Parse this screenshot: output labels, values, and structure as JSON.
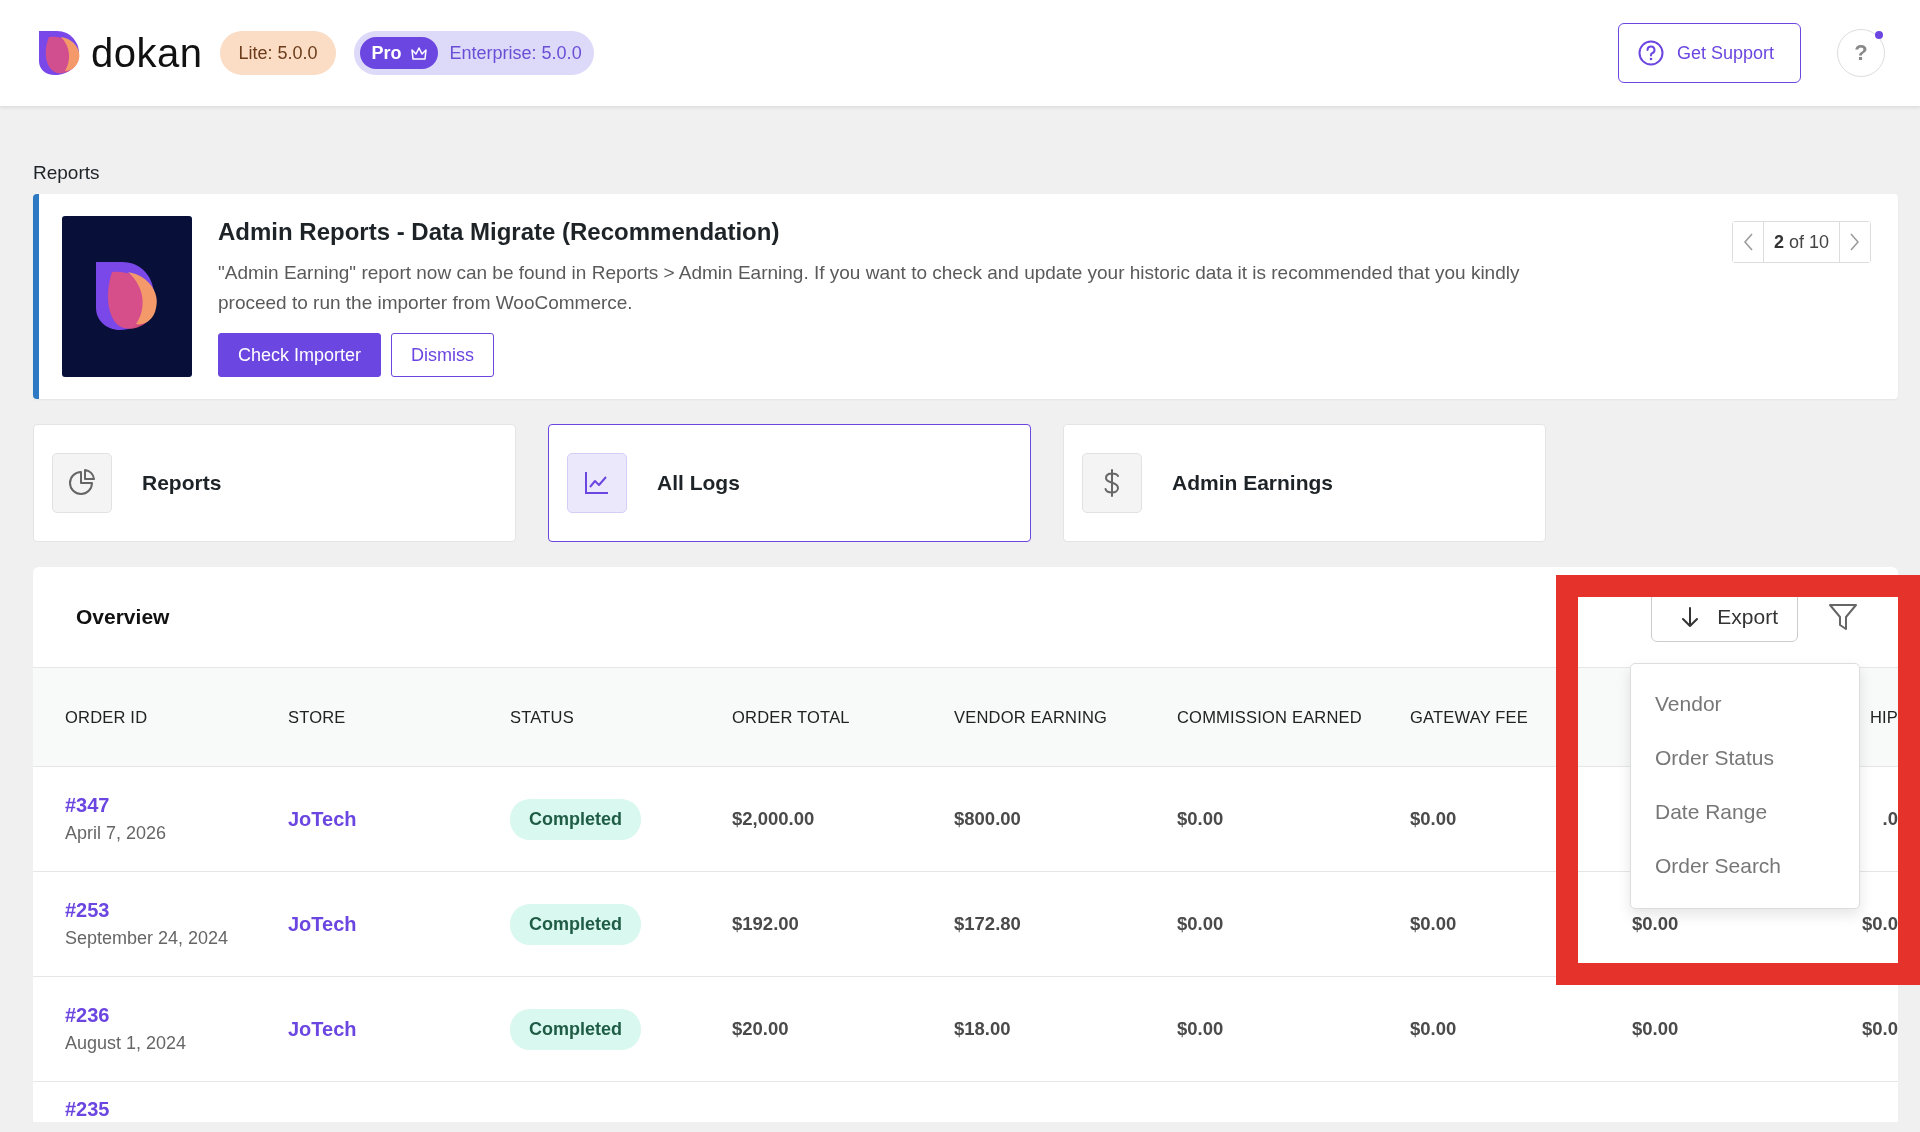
{
  "header": {
    "logo_text": "dokan",
    "lite_badge": "Lite: 5.0.0",
    "pro_badge": "Pro",
    "enterprise_badge": "Enterprise: 5.0.0",
    "support_button": "Get Support",
    "help_button": "?",
    "help_notification": true
  },
  "page_title": "Reports",
  "notice": {
    "title": "Admin Reports - Data Migrate (Recommendation)",
    "message": "\"Admin Earning\" report now can be found in Reports > Admin Earning. If you want to check and update your historic data it is recommended that you kindly proceed to run the importer from WooCommerce.",
    "buttons": [
      {
        "label": "Check Importer",
        "kind": "primary"
      },
      {
        "label": "Dismiss",
        "kind": "outline"
      }
    ],
    "pager": {
      "current": "2",
      "total": "of 10"
    }
  },
  "tabs": [
    {
      "label": "Reports",
      "kind": "pie",
      "selected": false
    },
    {
      "label": "All Logs",
      "kind": "line",
      "selected": true
    },
    {
      "label": "Admin Earnings",
      "kind": "dollar",
      "selected": false
    }
  ],
  "overview": {
    "title": "Overview",
    "export_button": "Export",
    "filter_menu": {
      "items": [
        "Vendor",
        "Order Status",
        "Date Range",
        "Order Search"
      ]
    },
    "table": {
      "columns": [
        "ORDER ID",
        "STORE",
        "STATUS",
        "ORDER TOTAL",
        "VENDOR EARNING",
        "COMMISSION EARNED",
        "GATEWAY FEE",
        null,
        "HIP"
      ],
      "rows": [
        {
          "order_id": "#347",
          "date": "April 7, 2026",
          "store": "JoTech",
          "status": "Completed",
          "order_total": "$2,000.00",
          "vendor_earning": "$800.00",
          "commission_earned": "$0.00",
          "gateway_fee": "$0.00",
          "column_9": ".0"
        },
        {
          "order_id": "#253",
          "date": "September 24, 2024",
          "store": "JoTech",
          "status": "Completed",
          "order_total": "$192.00",
          "vendor_earning": "$172.80",
          "commission_earned": "$0.00",
          "gateway_fee": "$0.00",
          "column_8": "$0.00",
          "column_9": "$0.0"
        },
        {
          "order_id": "#236",
          "date": "August 1, 2024",
          "store": "JoTech",
          "status": "Completed",
          "order_total": "$20.00",
          "vendor_earning": "$18.00",
          "commission_earned": "$0.00",
          "gateway_fee": "$0.00",
          "column_8": "$0.00",
          "column_9": "$0.0"
        },
        {
          "order_id": "#235"
        }
      ]
    }
  }
}
